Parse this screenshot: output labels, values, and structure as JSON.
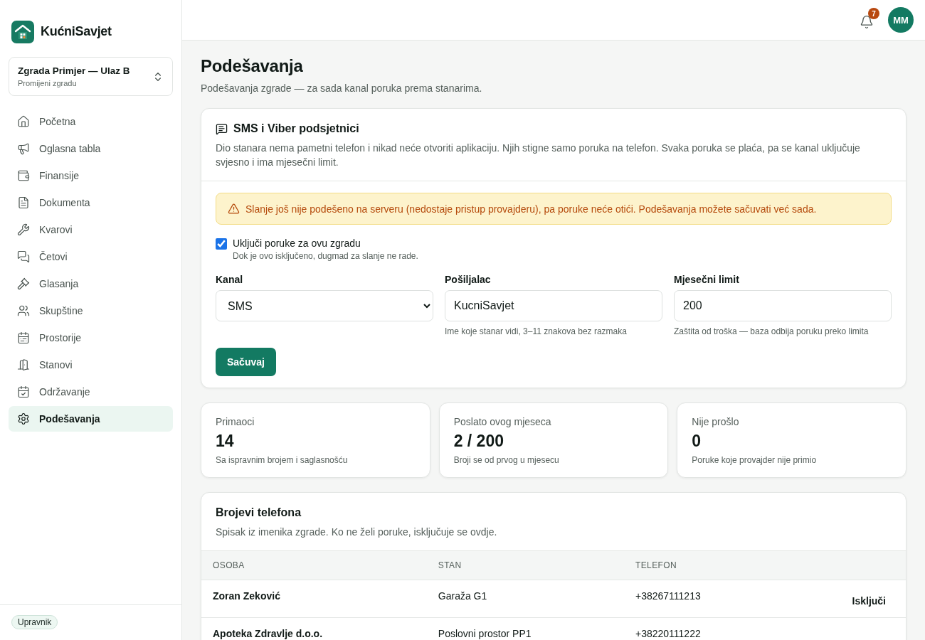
{
  "brand": {
    "name": "KućniSavjet"
  },
  "building": {
    "name": "Zgrada Primjer — Ulaz B",
    "hint": "Promijeni zgradu"
  },
  "nav": [
    {
      "kind": "home",
      "label": "Početna",
      "selected": false
    },
    {
      "kind": "megaphone",
      "label": "Oglasna tabla",
      "selected": false
    },
    {
      "kind": "wallet",
      "label": "Finansije",
      "selected": false
    },
    {
      "kind": "file",
      "label": "Dokumenta",
      "selected": false
    },
    {
      "kind": "wrench",
      "label": "Kvarovi",
      "selected": false
    },
    {
      "kind": "chats",
      "label": "Četovi",
      "selected": false
    },
    {
      "kind": "gavel",
      "label": "Glasanja",
      "selected": false
    },
    {
      "kind": "users",
      "label": "Skupštine",
      "selected": false
    },
    {
      "kind": "calendar",
      "label": "Prostorije",
      "selected": false
    },
    {
      "kind": "door",
      "label": "Stanovi",
      "selected": false
    },
    {
      "kind": "calendar-check",
      "label": "Održavanje",
      "selected": false
    },
    {
      "kind": "gear",
      "label": "Podešavanja",
      "selected": true
    }
  ],
  "role_badge": "Upravnik",
  "topbar": {
    "notifications": "7",
    "avatar": "MM"
  },
  "page": {
    "title": "Podešavanja",
    "subtitle": "Podešavanja zgrade — za sada kanal poruka prema stanarima."
  },
  "sms_card": {
    "title": "SMS i Viber podsjetnici",
    "description": "Dio stanara nema pametni telefon i nikad neće otvoriti aplikaciju. Njih stigne samo poruka na telefon. Svaka poruka se plaća, pa se kanal uključuje svjesno i ima mjesečni limit.",
    "warning": "Slanje još nije podešeno na serveru (nedostaje pristup provajderu), pa poruke neće otići. Podešavanja možete sačuvati već sada.",
    "enable": {
      "label": "Uključi poruke za ovu zgradu",
      "hint": "Dok je ovo isključeno, dugmad za slanje ne rade.",
      "checked": true
    },
    "fields": [
      {
        "kind": "select",
        "label": "Kanal",
        "value": "SMS"
      },
      {
        "kind": "input",
        "label": "Pošiljalac",
        "value": "KucniSavjet",
        "hint": "Ime koje stanar vidi, 3–11 znakova bez razmaka"
      },
      {
        "kind": "input",
        "label": "Mjesečni limit",
        "value": "200",
        "hint": "Zaštita od troška — baza odbija poruku preko limita"
      }
    ],
    "save": "Sačuvaj"
  },
  "stats": [
    {
      "label": "Primaoci",
      "value": "14",
      "hint": "Sa ispravnim brojem i saglasnošću"
    },
    {
      "label": "Poslato ovog mjeseca",
      "value": "2 / 200",
      "hint": "Broji se od prvog u mjesecu"
    },
    {
      "label": "Nije prošlo",
      "value": "0",
      "hint": "Poruke koje provajder nije primio"
    }
  ],
  "phones": {
    "title": "Brojevi telefona",
    "subtitle": "Spisak iz imenika zgrade. Ko ne želi poruke, isključuje se ovdje.",
    "columns": [
      "OSOBA",
      "STAN",
      "TELEFON"
    ],
    "rows": [
      {
        "person": "Zoran Zeković",
        "unit": "Garaža G1",
        "phone": "+38267111213",
        "action": "Isključi"
      },
      {
        "person": "Apoteka Zdravlje d.o.o.",
        "unit": "Poslovni prostor PP1",
        "phone": "+38220111222"
      }
    ]
  }
}
